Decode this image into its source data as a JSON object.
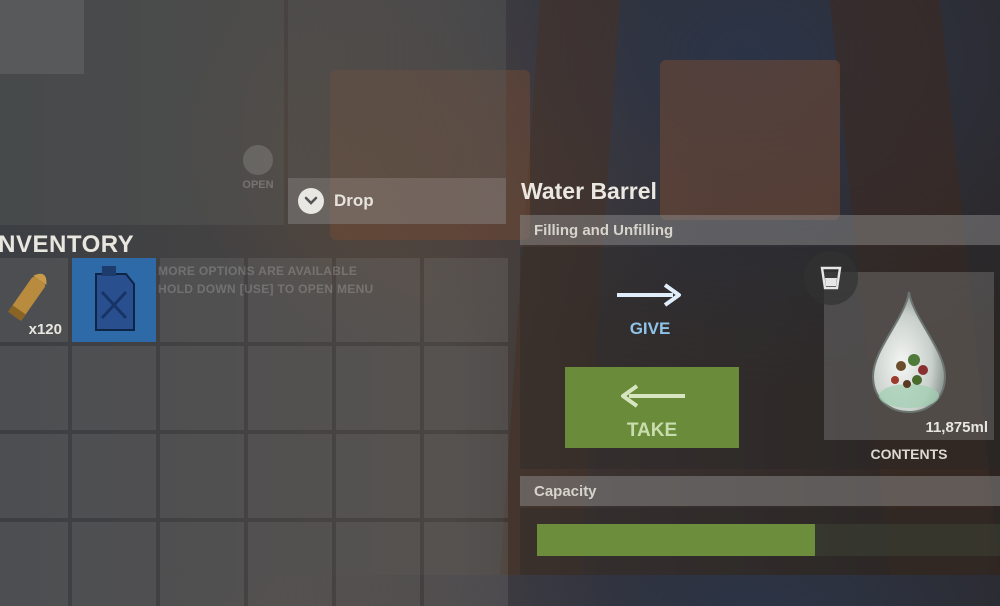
{
  "top": {
    "open_hint": "OPEN",
    "drop_label": "Drop"
  },
  "inventory": {
    "title": "INVENTORY",
    "hint_line1": "MORE OPTIONS ARE AVAILABLE",
    "hint_line2": "HOLD DOWN [USE] TO OPEN MENU",
    "slots": [
      {
        "item": "rifle-ammo",
        "qty": "x120"
      },
      {
        "item": "jerry-can",
        "qty": "",
        "selected": true
      },
      {
        "item": ""
      },
      {
        "item": ""
      },
      {
        "item": ""
      },
      {
        "item": ""
      },
      {
        "item": ""
      },
      {
        "item": ""
      },
      {
        "item": ""
      },
      {
        "item": ""
      },
      {
        "item": ""
      },
      {
        "item": ""
      },
      {
        "item": ""
      },
      {
        "item": ""
      },
      {
        "item": ""
      },
      {
        "item": ""
      },
      {
        "item": ""
      },
      {
        "item": ""
      },
      {
        "item": ""
      },
      {
        "item": ""
      },
      {
        "item": ""
      },
      {
        "item": ""
      },
      {
        "item": ""
      },
      {
        "item": ""
      }
    ]
  },
  "loot": {
    "title": "Water Barrel",
    "filling_header": "Filling and Unfilling",
    "give_label": "GIVE",
    "take_label": "TAKE",
    "contents_amount": "11,875ml",
    "contents_label": "CONTENTS",
    "contents_icon": "dirty-water-drop-icon",
    "capacity_header": "Capacity",
    "capacity_fraction": 0.6
  },
  "colors": {
    "take_green": "#6a8c3a",
    "capacity_green": "#6c8d3c",
    "give_blue": "#8fc3e8",
    "selected_slot_blue": "#2f6aa8"
  }
}
